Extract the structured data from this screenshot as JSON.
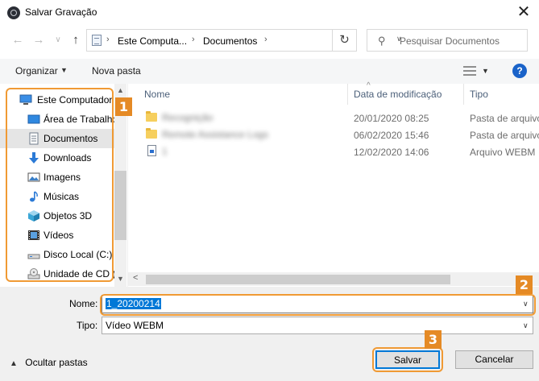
{
  "window": {
    "title": "Salvar Gravação",
    "close_glyph": "✕",
    "app_icon": "electron-app-icon"
  },
  "navigation": {
    "back_glyph": "←",
    "forward_glyph": "→",
    "recent_glyph": "∨",
    "up_glyph": "↑"
  },
  "address": {
    "crumbs": [
      "Este Computa...",
      "Documentos"
    ],
    "separator": "›",
    "dropdown_glyph": "∨",
    "refresh_glyph": "↻"
  },
  "search": {
    "placeholder": "Pesquisar Documentos",
    "icon_glyph": "⚲"
  },
  "toolbar": {
    "organize_label": "Organizar",
    "organize_arrow": "▼",
    "new_folder_label": "Nova pasta",
    "view_arrow": "▼",
    "help_label": "?"
  },
  "sidebar": {
    "items": [
      {
        "label": "Este Computador",
        "icon": "computer-icon"
      },
      {
        "label": "Área de Trabalho",
        "icon": "desktop-icon"
      },
      {
        "label": "Documentos",
        "icon": "documents-icon",
        "selected": true
      },
      {
        "label": "Downloads",
        "icon": "downloads-icon"
      },
      {
        "label": "Imagens",
        "icon": "pictures-icon"
      },
      {
        "label": "Músicas",
        "icon": "music-icon"
      },
      {
        "label": "Objetos 3D",
        "icon": "objects-3d-icon"
      },
      {
        "label": "Vídeos",
        "icon": "videos-icon"
      },
      {
        "label": "Disco Local (C:)",
        "icon": "local-disk-icon"
      },
      {
        "label": "Unidade de CD (",
        "icon": "cd-drive-icon"
      }
    ],
    "scroll_up_glyph": "▲",
    "scroll_down_glyph": "▼"
  },
  "filelist": {
    "columns": {
      "name": "Nome",
      "date": "Data de modificação",
      "type": "Tipo"
    },
    "sort_glyph": "^",
    "files": [
      {
        "name": "Recognição",
        "date": "20/01/2020 08:25",
        "type": "Pasta de arquivo",
        "icon": "folder-icon"
      },
      {
        "name": "Remote Assistance Logs",
        "date": "06/02/2020 15:46",
        "type": "Pasta de arquivo",
        "icon": "folder-icon"
      },
      {
        "name": "1",
        "date": "12/02/2020 14:06",
        "type": "Arquivo WEBM",
        "icon": "video-file-icon"
      }
    ],
    "hscroll_left_glyph": "<"
  },
  "form": {
    "name_label": "Nome:",
    "name_value": "1_20200214",
    "type_label": "Tipo:",
    "type_value": "Vídeo WEBM",
    "dropdown_glyph": "∨"
  },
  "footer": {
    "hide_folders_arrow": "▲",
    "hide_folders_label": "Ocultar pastas",
    "save_label": "Salvar",
    "cancel_label": "Cancelar"
  },
  "annotations": {
    "badge_1": "1",
    "badge_2": "2",
    "badge_3": "3",
    "color": "#e58a25"
  }
}
